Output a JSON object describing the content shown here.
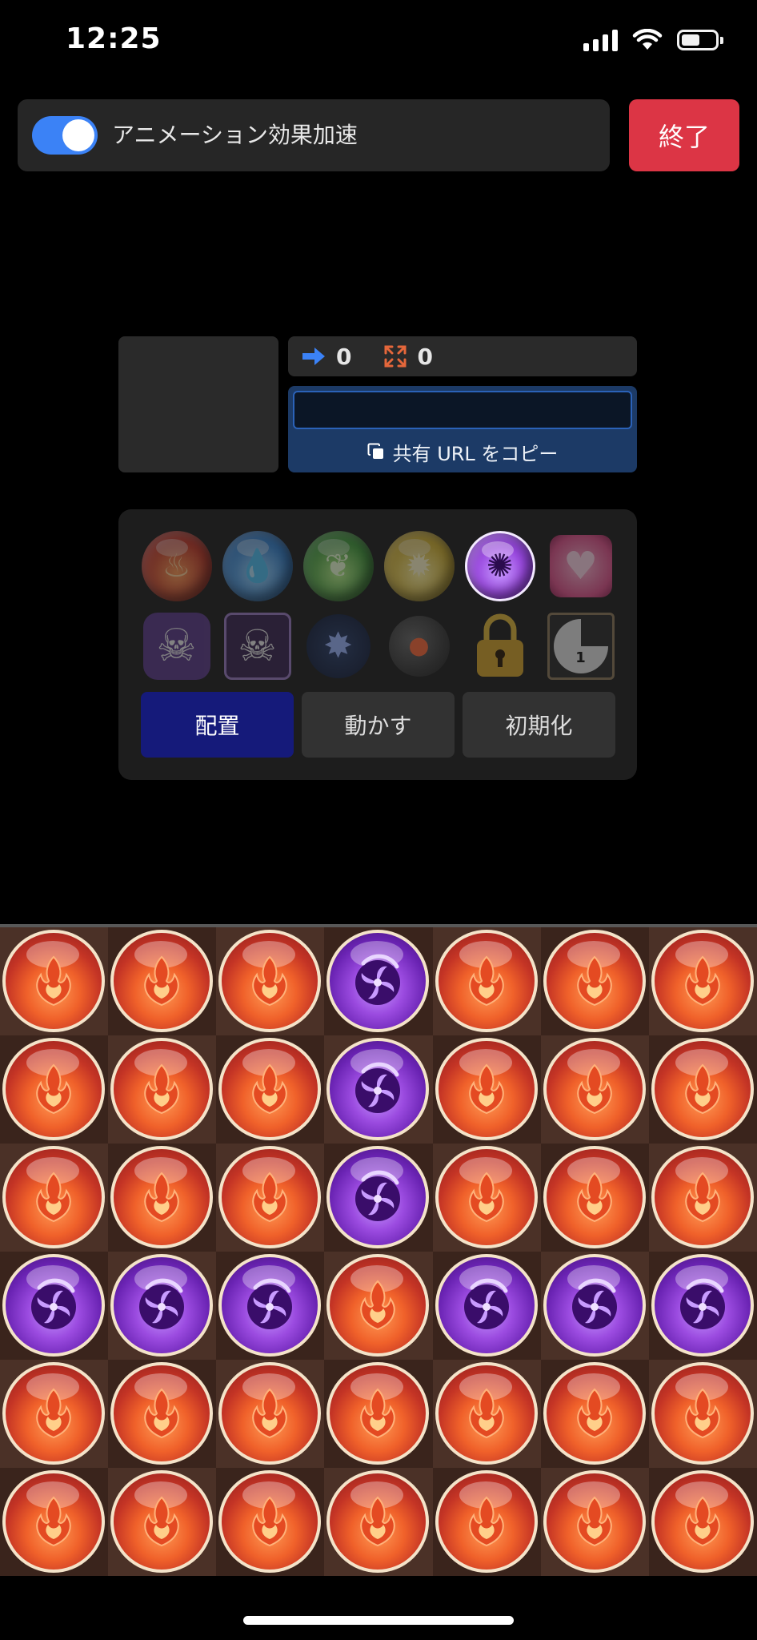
{
  "status_bar": {
    "time": "12:25"
  },
  "toggle": {
    "label": "アニメーション効果加速",
    "enabled": true
  },
  "end_button": {
    "label": "終了"
  },
  "counters": {
    "moves": "0",
    "combos": "0"
  },
  "share": {
    "input_value": "",
    "copy_label": "共有 URL をコピー"
  },
  "palette": {
    "row1": [
      "fire-orb",
      "water-orb",
      "wood-orb",
      "light-orb",
      "dark-orb",
      "heart-orb"
    ],
    "row2": [
      "poison-orb",
      "deadly-poison-orb",
      "jammer-orb",
      "bomb-orb",
      "lock-icon",
      "countdown-orb"
    ],
    "selected": "dark-orb",
    "countdown_value": "1"
  },
  "modes": [
    {
      "label": "配置",
      "active": true
    },
    {
      "label": "動かす",
      "active": false
    },
    {
      "label": "初期化",
      "active": false
    }
  ],
  "board": {
    "columns": 7,
    "rows": [
      [
        "fire",
        "fire",
        "fire",
        "dark",
        "fire",
        "fire",
        "fire"
      ],
      [
        "fire",
        "fire",
        "fire",
        "dark",
        "fire",
        "fire",
        "fire"
      ],
      [
        "fire",
        "fire",
        "fire",
        "dark",
        "fire",
        "fire",
        "fire"
      ],
      [
        "dark",
        "dark",
        "dark",
        "fire",
        "dark",
        "dark",
        "dark"
      ],
      [
        "fire",
        "fire",
        "fire",
        "fire",
        "fire",
        "fire",
        "fire"
      ],
      [
        "fire",
        "fire",
        "fire",
        "fire",
        "fire",
        "fire",
        "fire"
      ]
    ]
  },
  "colors": {
    "accent_blue": "#3b82f6",
    "end_red": "#dc3545",
    "active_mode": "#151a7a",
    "board_light": "#4b3127",
    "board_dark": "#3a241c"
  }
}
